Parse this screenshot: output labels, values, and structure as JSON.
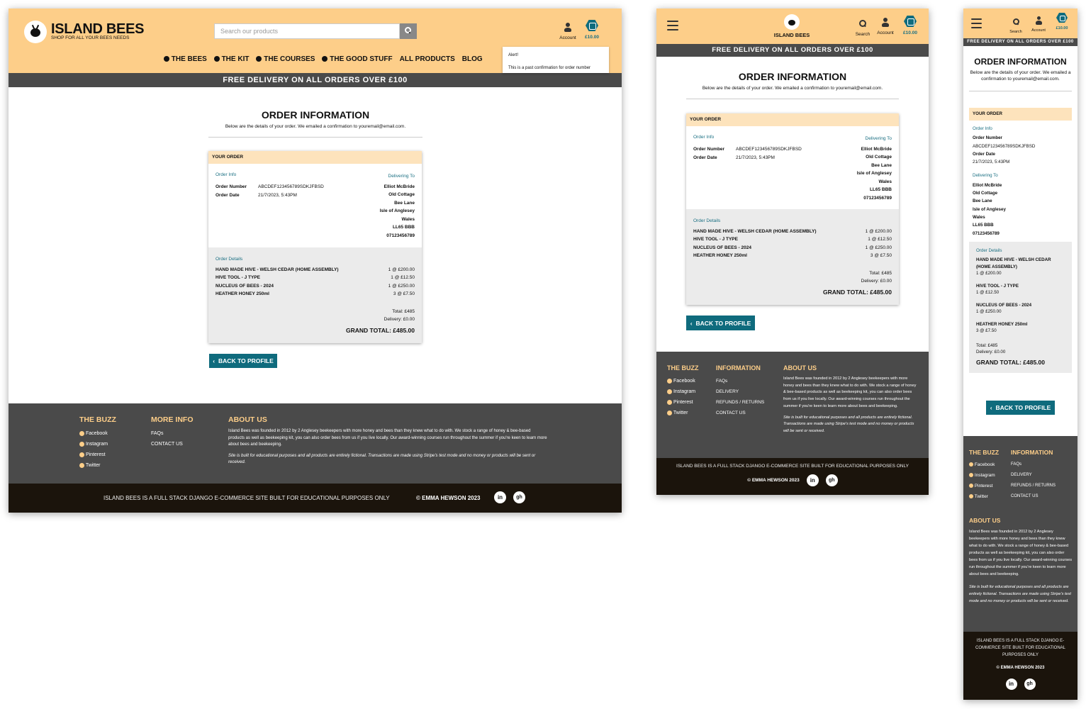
{
  "brand": {
    "name": "ISLAND BEES",
    "tagline": "SHOP FOR ALL YOUR BEES NEEDS"
  },
  "search": {
    "placeholder": "Search our products",
    "label": "Search"
  },
  "account": {
    "label": "Account"
  },
  "basket": {
    "total": "£10.00"
  },
  "nav": [
    "THE BEES",
    "THE KIT",
    "THE COURSES",
    "THE GOOD STUFF",
    "ALL PRODUCTS",
    "BLOG"
  ],
  "alert": {
    "title": "Alert!",
    "text": "This is a past confirmation for order number"
  },
  "banner": "FREE DELIVERY ON ALL ORDERS OVER £100",
  "page": {
    "title": "ORDER INFORMATION",
    "subtitle": "Below are the details of your order. We emailed a confirmation to youremail@email.com."
  },
  "order": {
    "header": "YOUR ORDER",
    "info_heading": "Order Info",
    "number_label": "Order Number",
    "number": "ABCDEF123456789SDKJFBSD",
    "date_label": "Order Date",
    "date": "21/7/2023, 5:43PM",
    "delivering_heading": "Delivering To",
    "address": [
      "Elliot McBride",
      "Old Cottage",
      "Bee Lane",
      "Isle of Anglesey",
      "Wales",
      "LL65 BBB",
      "07123456789"
    ],
    "details_heading": "Order Details",
    "items": [
      {
        "name": "HAND MADE HIVE - WELSH CEDAR (HOME ASSEMBLY)",
        "qty": "1 @ £200.00"
      },
      {
        "name": "HIVE TOOL - J TYPE",
        "qty": "1 @ £12.50"
      },
      {
        "name": "NUCLEUS OF BEES - 2024",
        "qty": "1 @ £250.00"
      },
      {
        "name": "HEATHER HONEY 250ml",
        "qty": "3 @ £7.50"
      }
    ],
    "total": "Total: £485",
    "delivery": "Delivery: £0.00",
    "grand_total": "GRAND TOTAL: £485.00"
  },
  "back_button": "BACK TO PROFILE",
  "footer": {
    "buzz_heading": "THE BUZZ",
    "social": [
      "Facebook",
      "Instagram",
      "Pinterest",
      "Twitter"
    ],
    "more_heading": "MORE INFO",
    "more_links": [
      "FAQs",
      "CONTACT US"
    ],
    "info_heading": "INFORMATION",
    "info_links": [
      "FAQs",
      "DELIVERY",
      "REFUNDS / RETURNS",
      "CONTACT US"
    ],
    "about_heading": "ABOUT US",
    "about_text": "Island Bees was founded in 2012 by 2 Anglesey beekeepers with more honey and bees than they knew what to do with.  We stock a range of honey & bee-based products as well as beekeeping kit, you can also order bees from us if you live locally. Our award-winning courses run throughout the summer if you're keen to learn more about bees and beekeeping.",
    "disclaimer": "Site is built for educational purposes and all products are entirely fictional. Transactions are made using Stripe's test mode and no money or products will be sent or received.",
    "bottom_text": "ISLAND BEES IS A FULL STACK DJANGO E-COMMERCE SITE BUILT FOR EDUCATIONAL PURPOSES ONLY",
    "copyright": "© EMMA HEWSON 2023",
    "linkedin": "in",
    "github": "gh"
  },
  "colors": {
    "header": "#fdce89",
    "banner": "#4a4a4a",
    "accent": "#0f6b7d",
    "footer": "#4a4a4a",
    "footer_bottom": "#1b140c"
  }
}
